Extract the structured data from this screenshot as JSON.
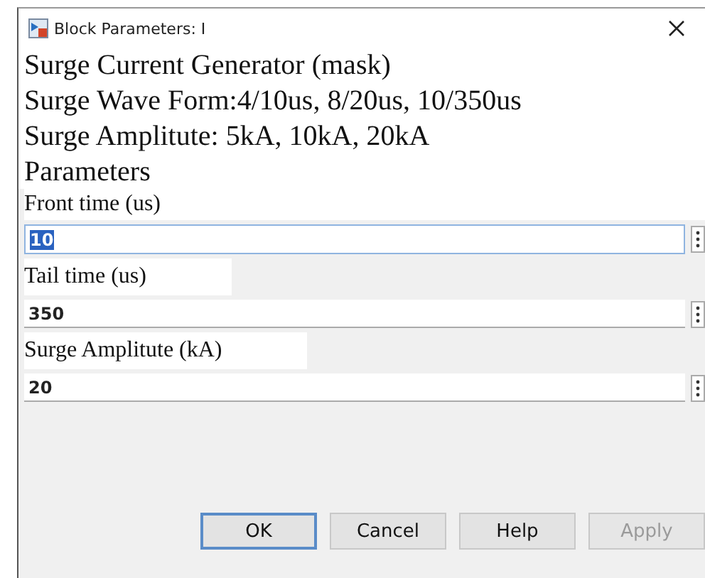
{
  "window": {
    "title": "Block Parameters: I"
  },
  "description": [
    "Surge Current Generator (mask)",
    "Surge Wave Form:4/10us, 8/20us, 10/350us",
    "Surge Amplitute: 5kA, 10kA, 20kA"
  ],
  "section": "Parameters",
  "parameters": [
    {
      "label": "Front time (us)",
      "value": "10",
      "focused": true
    },
    {
      "label": "Tail time (us)",
      "value": "350",
      "focused": false
    },
    {
      "label": "Surge Amplitute (kA)",
      "value": "20",
      "focused": false
    }
  ],
  "buttons": [
    {
      "label": "OK",
      "default": true,
      "disabled": false
    },
    {
      "label": "Cancel",
      "default": false,
      "disabled": false
    },
    {
      "label": "Help",
      "default": false,
      "disabled": false
    },
    {
      "label": "Apply",
      "default": false,
      "disabled": true
    }
  ]
}
